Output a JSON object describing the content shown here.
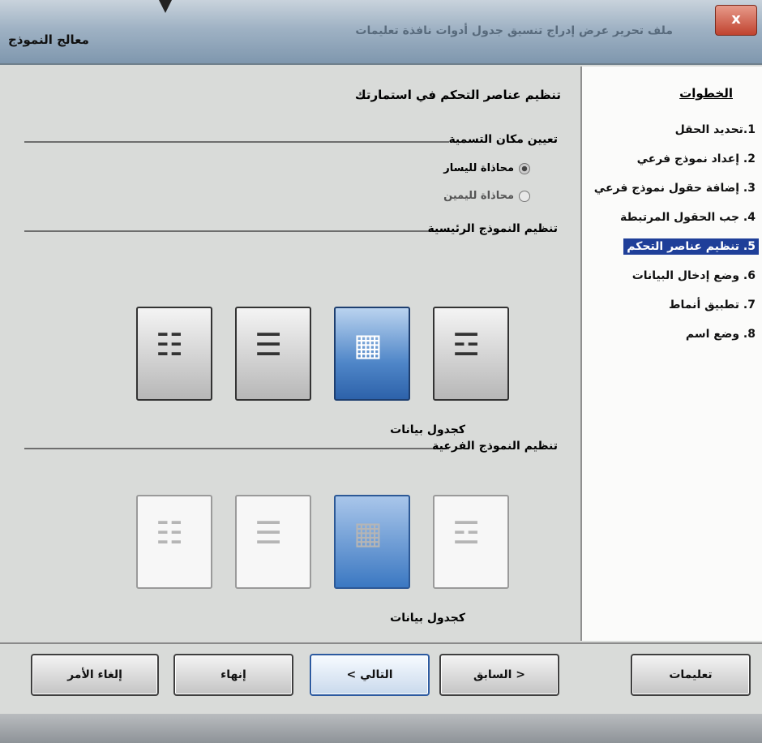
{
  "window": {
    "title": "معالج النموذج",
    "menu_blur": "ملف  تحرير  عرض  إدراج  تنسيق  جدول  أدوات  نافذة  تعليمات",
    "close_glyph": "x"
  },
  "steps": {
    "title": "الخطوات",
    "items": [
      {
        "label": "1.تحديد الحقل",
        "active": false
      },
      {
        "label": "2. إعداد نموذج فرعي",
        "active": false
      },
      {
        "label": "3. إضافة حقول نموذج فرعي",
        "active": false
      },
      {
        "label": "4. جب الحقول المرتبطة",
        "active": false
      },
      {
        "label": "5. تنظيم عناصر التحكم",
        "active": true
      },
      {
        "label": "6. وضع إدخال البيانات",
        "active": false
      },
      {
        "label": "7. تطبيق أنماط",
        "active": false
      },
      {
        "label": "8. وضع اسم",
        "active": false
      }
    ]
  },
  "main": {
    "heading": "تنظيم عناصر التحكم في استمارتك",
    "label_position": {
      "legend": "تعيين مكان التسمية",
      "options": [
        {
          "label": "محاذاة لليسار",
          "selected": true
        },
        {
          "label": "محاذاة لليمين",
          "selected": false
        }
      ]
    },
    "main_form": {
      "legend": "تنظيم النموذج الرئيسية",
      "caption": "كجدول بيانات",
      "selected_index": 1,
      "icons": [
        "columnar-left-labels-icon",
        "columnar-top-labels-icon",
        "datasheet-icon",
        "blocks-icon"
      ]
    },
    "sub_form": {
      "legend": "تنظيم النموذج الفرعية",
      "caption": "كجدول بيانات",
      "selected_index": 1,
      "icons": [
        "columnar-left-labels-icon",
        "columnar-top-labels-icon",
        "datasheet-icon",
        "blocks-icon"
      ]
    }
  },
  "buttons": {
    "help": "تعليمات",
    "back": "< السابق",
    "next": "التالي >",
    "finish": "إنهاء",
    "cancel": "إلغاء الأمر"
  },
  "colors": {
    "selection": "#1f3f99",
    "selected_tile": "#2d62aa"
  }
}
